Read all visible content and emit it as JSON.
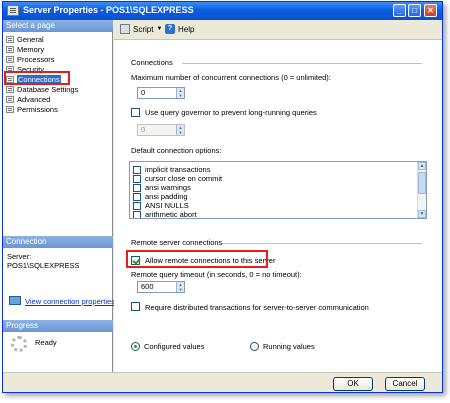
{
  "window": {
    "title": "Server Properties - POS1\\SQLEXPRESS"
  },
  "titlebar_buttons": {
    "minimize": "_",
    "maximize": "□",
    "close": "✕"
  },
  "left": {
    "select_page_header": "Select a page",
    "pages": [
      {
        "label": "General",
        "icon": "page-icon"
      },
      {
        "label": "Memory",
        "icon": "page-icon"
      },
      {
        "label": "Processors",
        "icon": "page-icon"
      },
      {
        "label": "Security",
        "icon": "page-icon"
      },
      {
        "label": "Connections",
        "icon": "page-icon",
        "selected": true
      },
      {
        "label": "Database Settings",
        "icon": "page-icon"
      },
      {
        "label": "Advanced",
        "icon": "page-icon"
      },
      {
        "label": "Permissions",
        "icon": "page-icon"
      }
    ],
    "connection_header": "Connection",
    "server_label": "Server:",
    "server_value": "POS1\\SQLEXPRESS",
    "view_connection_link": "View connection properties",
    "progress_header": "Progress",
    "progress_status": "Ready"
  },
  "toolbar": {
    "script_label": "Script",
    "help_label": "Help"
  },
  "connections": {
    "group_label": "Connections",
    "max_label": "Maximum number of concurrent connections (0 = unlimited):",
    "max_value": "0",
    "governor_label": "Use query governor to prevent long-running queries",
    "governor_checked": false,
    "governor_value": "0",
    "default_options_label": "Default connection options:",
    "options": [
      {
        "label": "implicit transactions",
        "checked": false
      },
      {
        "label": "cursor close on commit",
        "checked": false
      },
      {
        "label": "ansi warnings",
        "checked": false
      },
      {
        "label": "ansi padding",
        "checked": false
      },
      {
        "label": "ANSI NULLS",
        "checked": false
      },
      {
        "label": "arithmetic abort",
        "checked": false
      }
    ]
  },
  "remote": {
    "group_label": "Remote server connections",
    "allow_label": "Allow remote connections to this server",
    "allow_checked": true,
    "timeout_label": "Remote query timeout (in seconds, 0 = no timeout):",
    "timeout_value": "600",
    "distributed_label": "Require distributed transactions for server-to-server communication",
    "distributed_checked": false
  },
  "values_view": {
    "configured_label": "Configured values",
    "running_label": "Running values",
    "selected": "configured"
  },
  "footer": {
    "ok_label": "OK",
    "cancel_label": "Cancel"
  },
  "colors": {
    "highlight_box": "#e0201a",
    "selection": "#316ac5",
    "titlebar": "#0a5fe0"
  }
}
